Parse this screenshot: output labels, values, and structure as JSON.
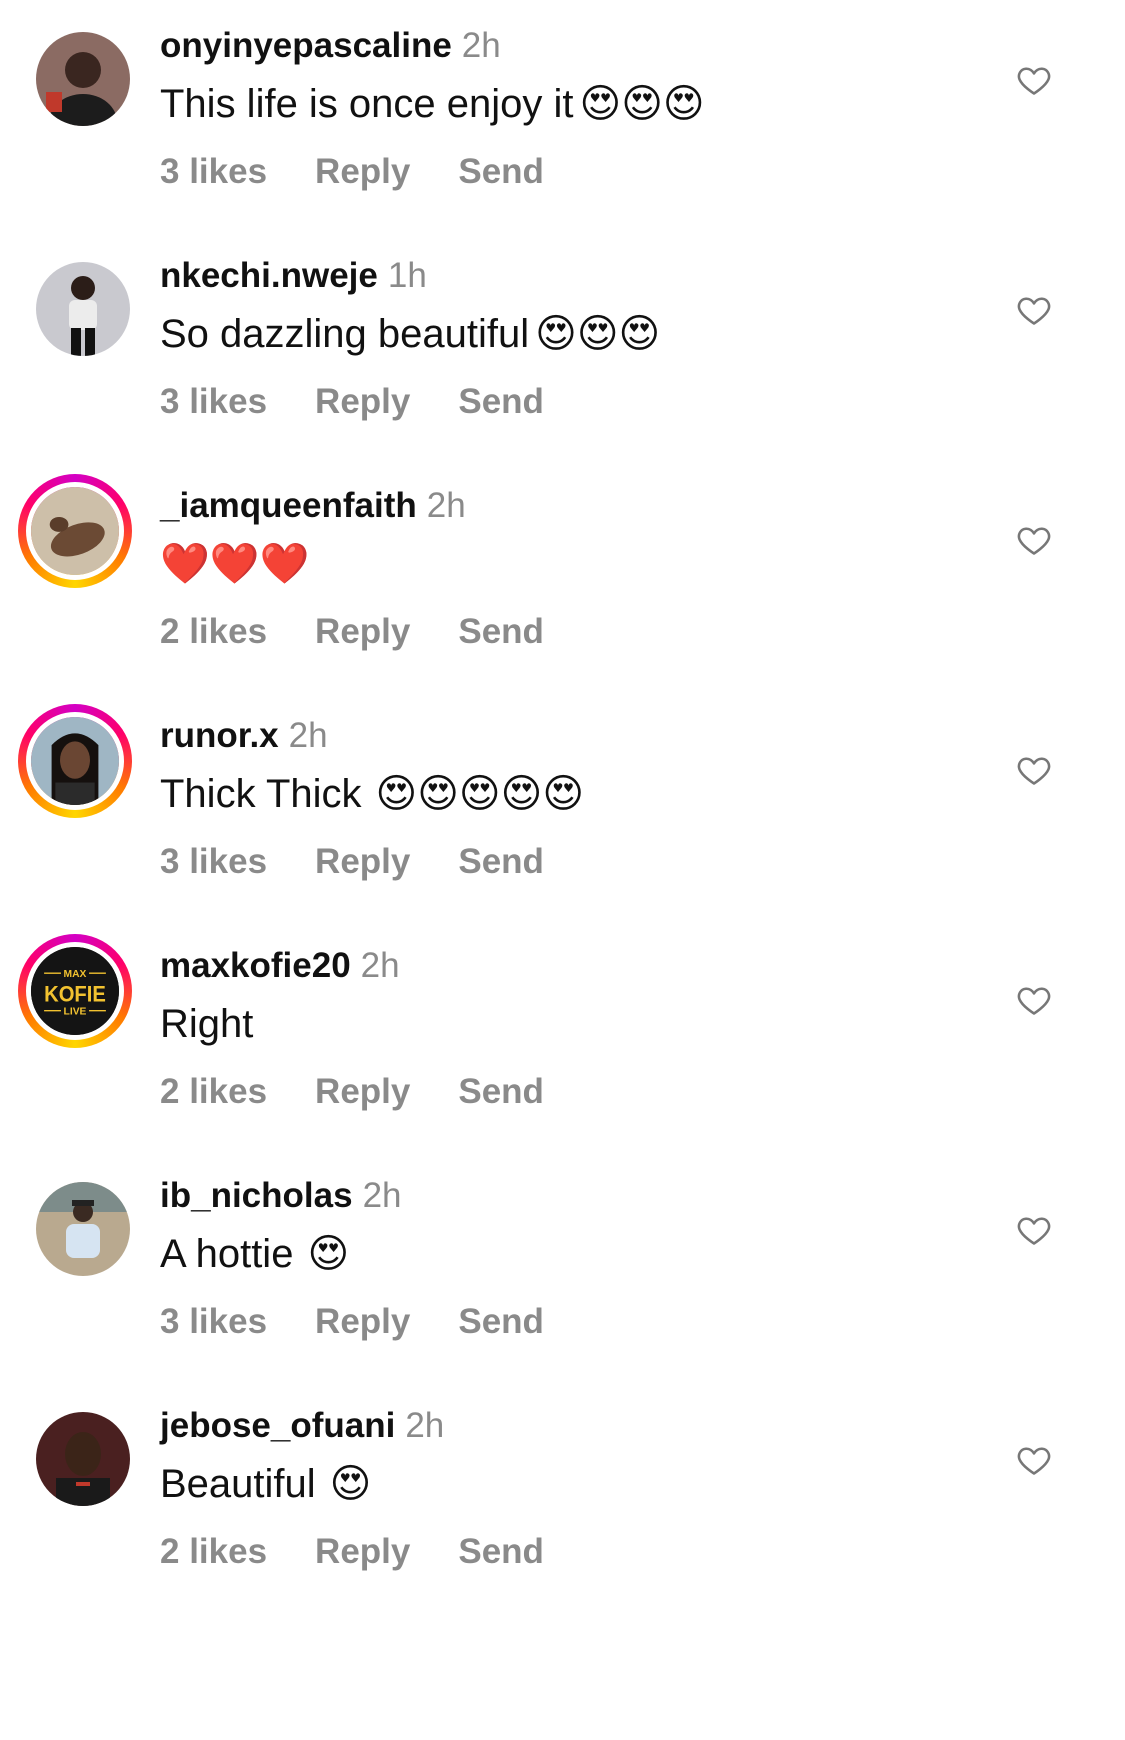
{
  "comments": [
    {
      "username": "onyinyepascaline",
      "time": "2h",
      "text": "This life is once enjoy it",
      "emoji": "😍😍😍",
      "likes": "3 likes",
      "reply": "Reply",
      "send": "Send"
    },
    {
      "username": "nkechi.nweje",
      "time": "1h",
      "text": "So dazzling beautiful",
      "emoji": "😍😍😍",
      "likes": "3 likes",
      "reply": "Reply",
      "send": "Send"
    },
    {
      "username": "_iamqueenfaith",
      "time": "2h",
      "text": "",
      "emoji": "❤️❤️❤️",
      "likes": "2 likes",
      "reply": "Reply",
      "send": "Send"
    },
    {
      "username": "runor.x",
      "time": "2h",
      "text": "Thick Thick",
      "emoji": "😍😍😍😍😍",
      "likes": "3 likes",
      "reply": "Reply",
      "send": "Send"
    },
    {
      "username": "maxkofie20",
      "time": "2h",
      "text": "Right",
      "emoji": "",
      "likes": "2 likes",
      "reply": "Reply",
      "send": "Send",
      "avatar_text": {
        "top": "MAX",
        "middle": "KOFIE",
        "bottom": "LIVE"
      }
    },
    {
      "username": "ib_nicholas",
      "time": "2h",
      "text": "A hottie",
      "emoji": "😍",
      "likes": "3 likes",
      "reply": "Reply",
      "send": "Send"
    },
    {
      "username": "jebose_ofuani",
      "time": "2h",
      "text": "Beautiful",
      "emoji": "😍",
      "likes": "2 likes",
      "reply": "Reply",
      "send": "Send"
    }
  ],
  "icons": {
    "like": "heart-outline-icon"
  },
  "colors": {
    "secondary_text": "#8a8a8a",
    "story_ring": [
      "#d300c5",
      "#ff0069",
      "#ff7a00",
      "#ffd600"
    ]
  }
}
